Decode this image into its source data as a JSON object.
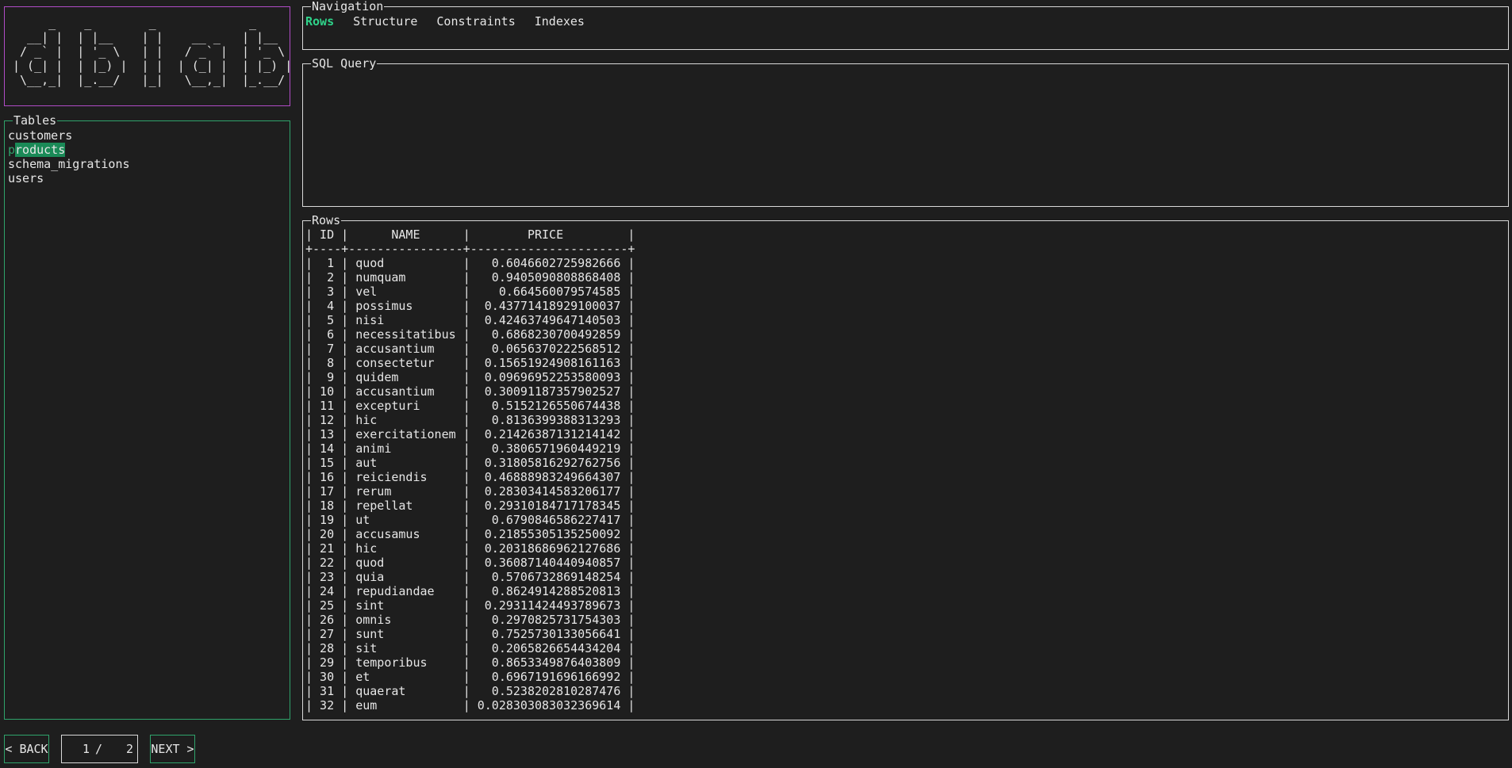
{
  "logo": {
    "art": "     _    _        _             _\n  __| |  | |__    | |    __ _   | |__\n / _` |  | '_ \\   | |   / _` |  | '_ \\\n| (_| |  | |_) |  | |  | (_| |  | |_) |\n \\__,_|  |_.__/   |_|   \\__,_|  |_.__/"
  },
  "tables": {
    "title": "Tables",
    "items": [
      {
        "label": "customers"
      },
      {
        "first": "p",
        "rest": "roducts"
      },
      {
        "label": "schema_migrations"
      },
      {
        "label": "users"
      }
    ]
  },
  "navigation": {
    "title": "Navigation",
    "tabs": [
      {
        "label": "Rows",
        "active": true
      },
      {
        "label": "Structure",
        "active": false
      },
      {
        "label": "Constraints",
        "active": false
      },
      {
        "label": "Indexes",
        "active": false
      }
    ]
  },
  "sql": {
    "title": "SQL Query",
    "value": ""
  },
  "rows": {
    "title": "Rows",
    "columns": [
      "ID",
      "NAME",
      "PRICE"
    ],
    "data": [
      [
        1,
        "quod",
        "0.6046602725982666"
      ],
      [
        2,
        "numquam",
        "0.9405090808868408"
      ],
      [
        3,
        "vel",
        "0.664560079574585"
      ],
      [
        4,
        "possimus",
        "0.43771418929100037"
      ],
      [
        5,
        "nisi",
        "0.4246374964714050 3"
      ],
      [
        6,
        "necessitatibus",
        "0.6868230700492859"
      ],
      [
        7,
        "accusantium",
        "0.0656370222568512"
      ],
      [
        8,
        "consectetur",
        "0.15651924908161163"
      ],
      [
        9,
        "quidem",
        "0.09696952253580093"
      ],
      [
        10,
        "accusantium",
        "0.30091187357902527"
      ],
      [
        11,
        "excepturi",
        "0.5152126550674438"
      ],
      [
        12,
        "hic",
        "0.8136399388313293"
      ],
      [
        13,
        "exercitationem",
        "0.21426387131214142"
      ],
      [
        14,
        "animi",
        "0.3806571960449219"
      ],
      [
        15,
        "aut",
        "0.31805816292762756"
      ],
      [
        16,
        "reiciendis",
        "0.46888983249664307"
      ],
      [
        17,
        "rerum",
        "0.28303414583206177"
      ],
      [
        18,
        "repellat",
        "0.29310184717178345"
      ],
      [
        19,
        "ut",
        "0.6790846586227417"
      ],
      [
        20,
        "accusamus",
        "0.21855305135250092"
      ],
      [
        21,
        "hic",
        "0.20318686962127686"
      ],
      [
        22,
        "quod",
        "0.36087140440940857"
      ],
      [
        23,
        "quia",
        "0.5706732869148254"
      ],
      [
        24,
        "repudiandae",
        "0.8624914288520813"
      ],
      [
        25,
        "sint",
        "0.29311424493789673"
      ],
      [
        26,
        "omnis",
        "0.2970825731754303"
      ],
      [
        27,
        "sunt",
        "0.7525730133056641"
      ],
      [
        28,
        "sit",
        "0.2065826654434204"
      ],
      [
        29,
        "temporibus",
        "0.8653349876403809"
      ],
      [
        30,
        "et",
        "0.6967191696166992"
      ],
      [
        31,
        "quaerat",
        "0.5238202810287476"
      ],
      [
        32,
        "eum",
        "0.028303083032369614"
      ]
    ]
  },
  "pagination": {
    "back_label": "< BACK",
    "next_label": "NEXT >",
    "current": "1",
    "separator": "/",
    "total": "2"
  },
  "colors": {
    "accent": "#2fa36b",
    "active_tab": "#2fd38a",
    "selection": "#1a8a57",
    "logo_border": "#b14cc7",
    "border": "#d9d9d9",
    "background": "#1e1e1e"
  }
}
